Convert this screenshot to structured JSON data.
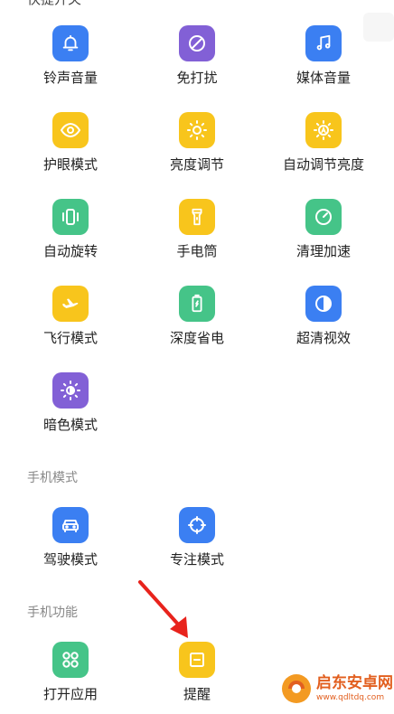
{
  "colors": {
    "blue": "#3b7ff2",
    "purple": "#8260d6",
    "yellow": "#f8c51c",
    "green": "#45c488",
    "red_arrow": "#e8231c"
  },
  "grid_items": [
    {
      "label": "铃声音量",
      "icon": "bell-icon"
    },
    {
      "label": "免打扰",
      "icon": "do-not-disturb-icon"
    },
    {
      "label": "媒体音量",
      "icon": "music-note-icon"
    },
    {
      "label": "护眼模式",
      "icon": "eye-icon"
    },
    {
      "label": "亮度调节",
      "icon": "sun-icon"
    },
    {
      "label": "自动调节亮度",
      "icon": "auto-brightness-icon"
    },
    {
      "label": "自动旋转",
      "icon": "rotate-icon"
    },
    {
      "label": "手电筒",
      "icon": "flashlight-icon"
    },
    {
      "label": "清理加速",
      "icon": "speedometer-icon"
    },
    {
      "label": "飞行模式",
      "icon": "airplane-icon"
    },
    {
      "label": "深度省电",
      "icon": "battery-icon"
    },
    {
      "label": "超清视效",
      "icon": "contrast-icon"
    },
    {
      "label": "暗色模式",
      "icon": "dark-mode-sun-icon"
    }
  ],
  "sections": {
    "phone_modes": {
      "title": "手机模式",
      "items": [
        {
          "label": "驾驶模式",
          "icon": "car-icon"
        },
        {
          "label": "专注模式",
          "icon": "focus-target-icon"
        }
      ]
    },
    "phone_functions": {
      "title": "手机功能",
      "items": [
        {
          "label": "打开应用",
          "icon": "app-grid-icon"
        },
        {
          "label": "提醒",
          "icon": "reminder-icon"
        }
      ]
    }
  },
  "watermark": {
    "title": "启东安卓网",
    "url": "www.qdltdq.com"
  },
  "top_cut_title": "快捷开关"
}
